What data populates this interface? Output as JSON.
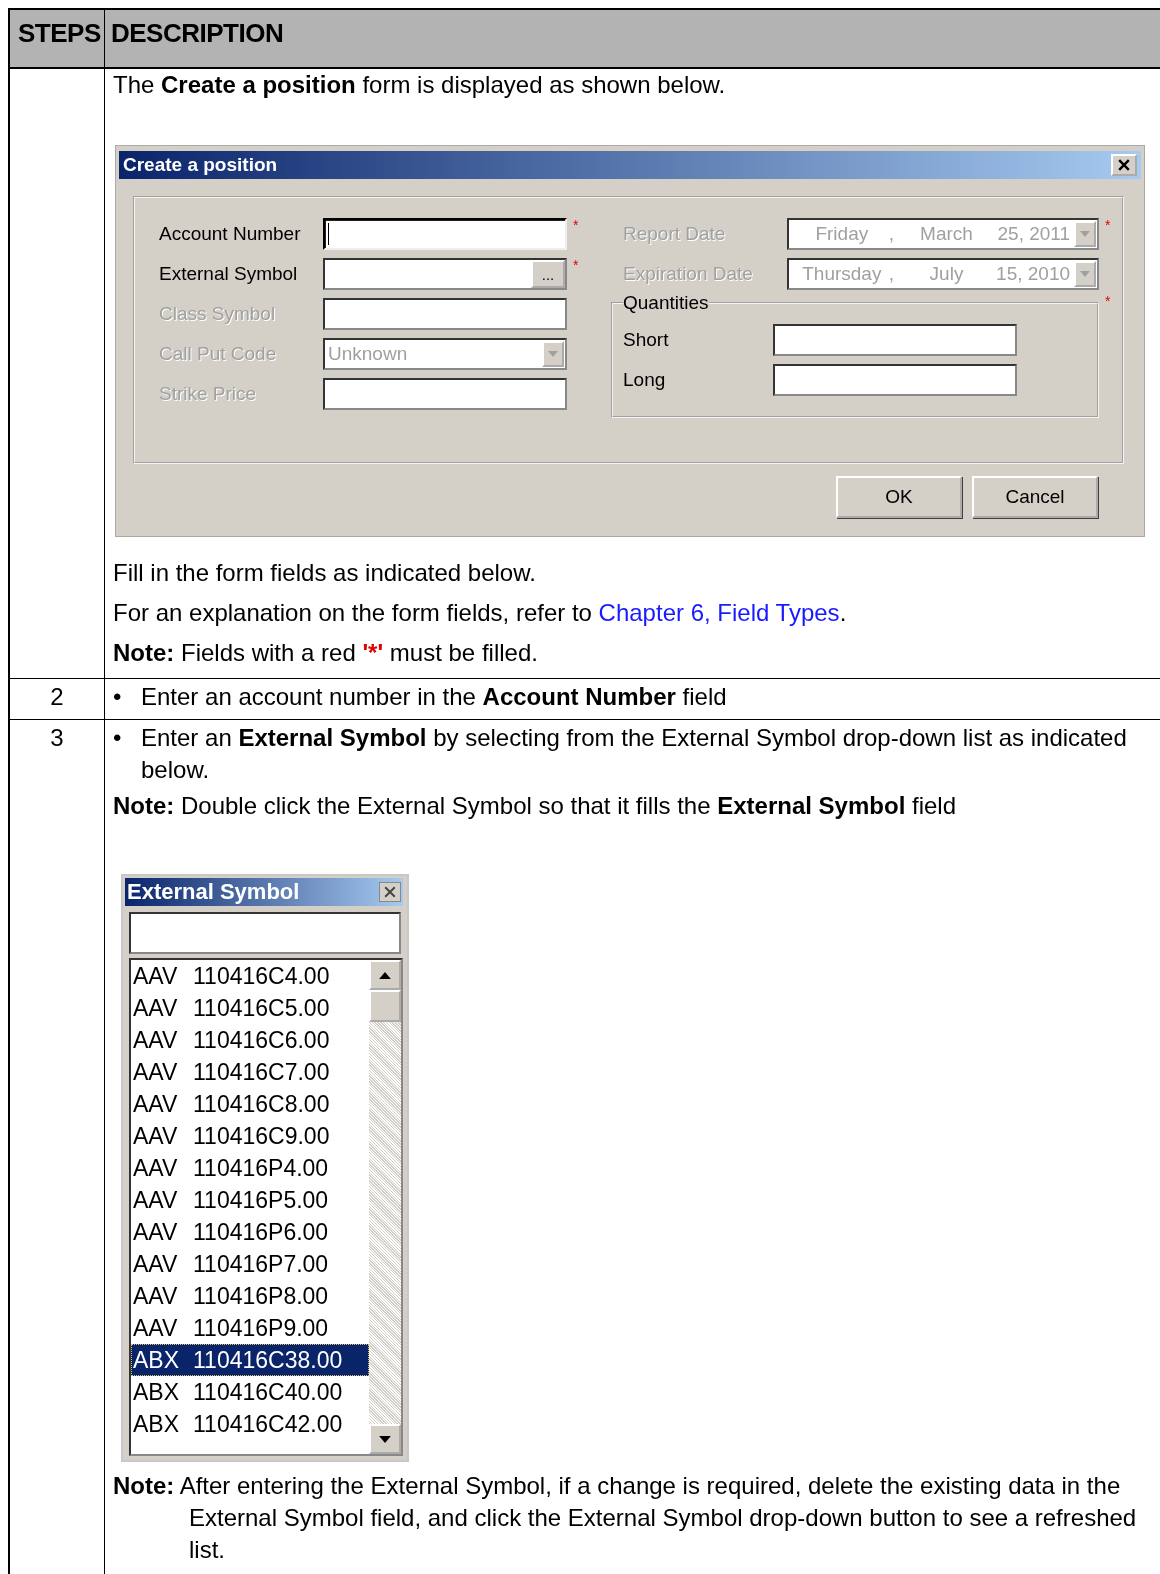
{
  "table": {
    "columns": [
      "STEPS",
      "DESCRIPTION"
    ],
    "rows": [
      {
        "step": "",
        "blocks": [
          {
            "kind": "paragraph",
            "segments": [
              {
                "text": "The **Create a position** form is displayed as shown below."
              }
            ]
          },
          {
            "kind": "dialog"
          },
          {
            "kind": "paragraph",
            "segments": [
              {
                "text": "Fill in the form fields as indicated below."
              }
            ]
          },
          {
            "kind": "paragraph",
            "segments": [
              {
                "text": "For an explanation on the form fields, refer to "
              },
              {
                "text": "Chapter 6, Field Types",
                "kind": "link"
              },
              {
                "text": "."
              }
            ]
          },
          {
            "kind": "paragraph",
            "segments": [
              {
                "text": "**Note:** Fields with a red "
              },
              {
                "text": "'*'",
                "kind": "red"
              },
              {
                "text": " must be filled."
              }
            ]
          }
        ]
      },
      {
        "step": "2",
        "blocks": [
          {
            "kind": "bullet",
            "bullet": "•",
            "text": "Enter an account number in the **Account Number** field"
          }
        ]
      },
      {
        "step": "3",
        "blocks": [
          {
            "kind": "bullet",
            "bullet": "•",
            "text": "Enter an **External Symbol** by selecting from the External Symbol drop-down list as indicated below."
          },
          {
            "kind": "note",
            "text": "**Note:** Double click the External Symbol so that it fills the **External Symbol** field"
          },
          {
            "kind": "picker"
          },
          {
            "kind": "note",
            "text": "**Note:** After entering the External Symbol, if a change is required, delete the existing data in the External Symbol field, and click the External Symbol drop-down button to see a refreshed list."
          }
        ]
      }
    ]
  },
  "dialog": {
    "title": "Create a position",
    "required_mark": "*",
    "left_fields": [
      {
        "label": "Account Number",
        "kind": "text",
        "disabled": false,
        "required": true,
        "focused": true
      },
      {
        "label": "External Symbol",
        "kind": "browse",
        "button": "...",
        "disabled": false,
        "required": true,
        "focused": false
      },
      {
        "label": "Class Symbol",
        "kind": "text",
        "disabled": true,
        "required": false,
        "focused": false
      },
      {
        "label": "Call Put Code",
        "kind": "select",
        "value": "Unknown",
        "disabled": true,
        "required": false,
        "focused": false
      },
      {
        "label": "Strike Price",
        "kind": "text",
        "disabled": true,
        "required": false,
        "focused": false
      }
    ],
    "right_fields": [
      {
        "label": "Report Date",
        "weekday": "Friday",
        "separator": ",",
        "month": "March",
        "day_year": "25, 2011",
        "disabled": true,
        "required": true
      },
      {
        "label": "Expiration Date",
        "weekday": "Thursday",
        "separator": ",",
        "month": "July",
        "day_year": "15, 2010",
        "disabled": true,
        "required": false
      }
    ],
    "quantities": {
      "legend": "Quantities",
      "required": true,
      "fields": [
        {
          "label": "Short"
        },
        {
          "label": "Long"
        }
      ]
    },
    "buttons": [
      "OK",
      "Cancel"
    ]
  },
  "picker": {
    "title": "External Symbol",
    "rows": [
      {
        "symbol": "AAV",
        "code": "110416C4.00",
        "selected": false
      },
      {
        "symbol": "AAV",
        "code": "110416C5.00",
        "selected": false
      },
      {
        "symbol": "AAV",
        "code": "110416C6.00",
        "selected": false
      },
      {
        "symbol": "AAV",
        "code": "110416C7.00",
        "selected": false
      },
      {
        "symbol": "AAV",
        "code": "110416C8.00",
        "selected": false
      },
      {
        "symbol": "AAV",
        "code": "110416C9.00",
        "selected": false
      },
      {
        "symbol": "AAV",
        "code": "110416P4.00",
        "selected": false
      },
      {
        "symbol": "AAV",
        "code": "110416P5.00",
        "selected": false
      },
      {
        "symbol": "AAV",
        "code": "110416P6.00",
        "selected": false
      },
      {
        "symbol": "AAV",
        "code": "110416P7.00",
        "selected": false
      },
      {
        "symbol": "AAV",
        "code": "110416P8.00",
        "selected": false
      },
      {
        "symbol": "AAV",
        "code": "110416P9.00",
        "selected": false
      },
      {
        "symbol": "ABX",
        "code": "110416C38.00",
        "selected": true
      },
      {
        "symbol": "ABX",
        "code": "110416C40.00",
        "selected": false
      },
      {
        "symbol": "ABX",
        "code": "110416C42.00",
        "selected": false
      }
    ]
  }
}
